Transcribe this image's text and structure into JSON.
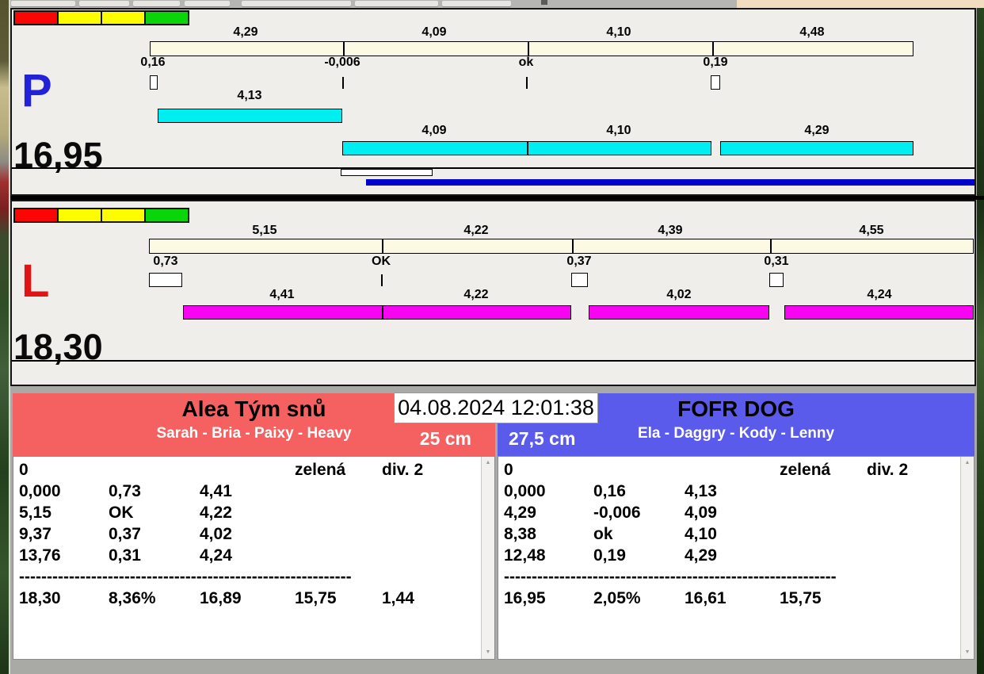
{
  "clock": "04.08.2024 12:01:38",
  "lanes": [
    {
      "letter": "P",
      "total": "16,95",
      "splits": [
        "4,29",
        "4,09",
        "4,10",
        "4,48"
      ],
      "marks": [
        "0,16",
        "-0,006",
        "ok",
        "0,19"
      ],
      "runs": [
        "4,13",
        "4,09",
        "4,10",
        "4,29"
      ]
    },
    {
      "letter": "L",
      "total": "18,30",
      "splits": [
        "5,15",
        "4,22",
        "4,39",
        "4,55"
      ],
      "marks": [
        "0,73",
        "OK",
        "0,37",
        "0,31"
      ],
      "runs": [
        "4,41",
        "4,22",
        "4,02",
        "4,24"
      ]
    }
  ],
  "teams": [
    {
      "name": "Alea Tým snů",
      "dogs": "Sarah - Bria - Paixy - Heavy",
      "jump_height": "25 cm",
      "accent": "#f56060",
      "rows": [
        [
          "0",
          "",
          "",
          "zelená",
          "div. 2"
        ],
        [
          "0,000",
          "0,73",
          "4,41",
          "",
          ""
        ],
        [
          "5,15",
          "OK",
          "4,22",
          "",
          ""
        ],
        [
          "9,37",
          "0,37",
          "4,02",
          "",
          ""
        ],
        [
          "13,76",
          "0,31",
          "4,24",
          "",
          ""
        ]
      ],
      "separator": "------------------------------------------------------------",
      "summary": [
        "18,30",
        "8,36%",
        "16,89",
        "15,75",
        "1,44"
      ]
    },
    {
      "name": "FOFR DOG",
      "dogs": "Ela - Daggry - Kody - Lenny",
      "jump_height": "27,5 cm",
      "accent": "#5b5beb",
      "rows": [
        [
          "0",
          "",
          "",
          "zelená",
          "div. 2"
        ],
        [
          "0,000",
          "0,16",
          "4,13",
          "",
          ""
        ],
        [
          "4,29",
          "-0,006",
          "4,09",
          "",
          ""
        ],
        [
          "8,38",
          "ok",
          "4,10",
          "",
          ""
        ],
        [
          "12,48",
          "0,19",
          "4,29",
          "",
          ""
        ]
      ],
      "separator": "------------------------------------------------------------",
      "summary": [
        "16,95",
        "2,05%",
        "16,61",
        "15,75",
        ""
      ]
    }
  ],
  "colors": {
    "schedule_bar": "#fcfae2",
    "run_bar_p": "#00eef2",
    "run_bar_l": "#f705f0",
    "progress": "#0000cc",
    "lane_p_letter": "#2222d8",
    "lane_l_letter": "#e01414",
    "lights": [
      "#fb0505",
      "#fdfd00",
      "#fdfd00",
      "#09d509"
    ]
  }
}
